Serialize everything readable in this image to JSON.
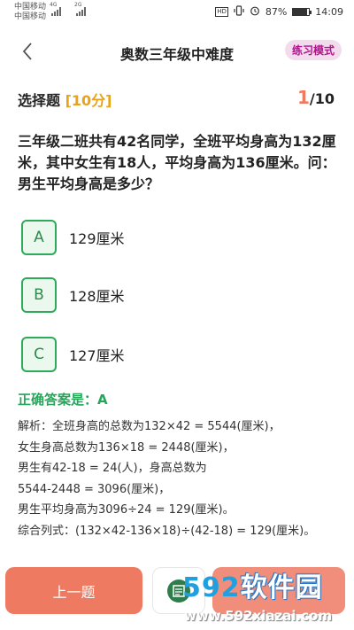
{
  "status_bar": {
    "carrier1": "中国移动",
    "carrier2": "中国移动",
    "net1": "4G",
    "net2": "2G",
    "hd": "HD",
    "battery_text": "87%",
    "battery_level": 0.87,
    "time": "14:09"
  },
  "header": {
    "title": "奥数三年级中难度",
    "mode_label": "练习模式"
  },
  "question_meta": {
    "type_label": "选择题",
    "score_label": "[10分]",
    "current": "1",
    "total": "/10"
  },
  "question": {
    "text": "三年级二班共有42名同学，全班平均身高为132厘米，其中女生有18人，平均身高为136厘米。问：男生平均身高是多少？"
  },
  "options": [
    {
      "letter": "A",
      "text": "129厘米"
    },
    {
      "letter": "B",
      "text": "128厘米"
    },
    {
      "letter": "C",
      "text": "127厘米"
    }
  ],
  "answer": {
    "label": "正确答案是：A"
  },
  "explanation": {
    "lines": [
      "解析：全班身高的总数为132×42 = 5544(厘米)，",
      "女生身高总数为136×18 = 2448(厘米)，",
      "男生有42-18 = 24(人)，身高总数为",
      "5544-2448 = 3096(厘米)，",
      "男生平均身高为3096÷24 = 129(厘米)。",
      "综合列式：(132×42-136×18)÷(42-18) = 129(厘米)。"
    ]
  },
  "footer": {
    "prev_label": "上一题"
  },
  "watermark": {
    "logo_num": "592",
    "logo_text": "软件园",
    "url": "www.592xiazai.com"
  },
  "colors": {
    "accent": "#ef7a62",
    "option_green": "#2faa5a",
    "answer_green": "#26a65b",
    "mode_bg": "#f3dbee",
    "mode_text": "#b1138d",
    "score_orange": "#e8a317"
  }
}
